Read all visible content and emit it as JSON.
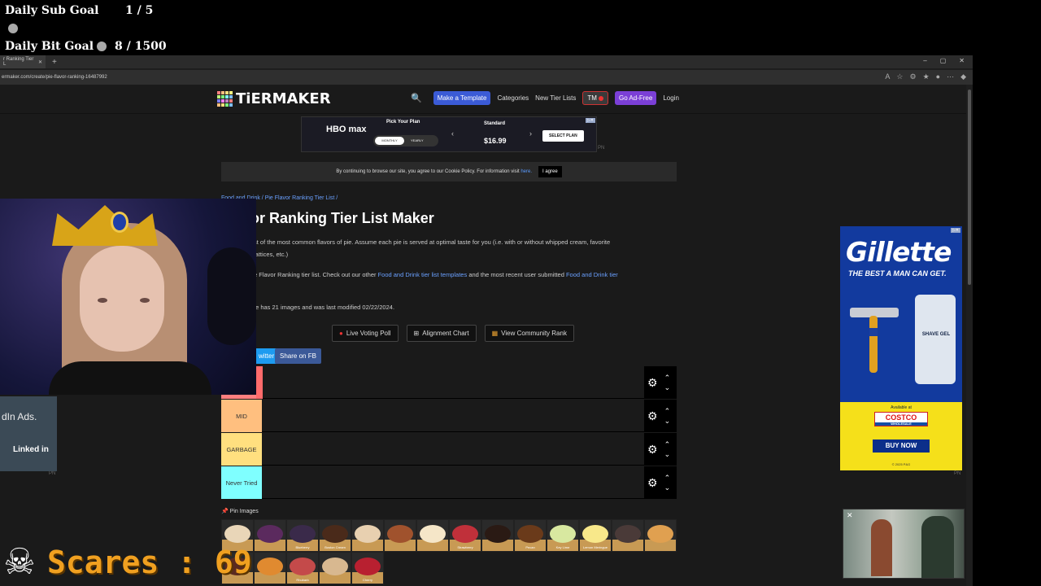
{
  "stream_overlay": {
    "sub_goal_label": "Daily Sub Goal",
    "sub_goal_value": "1 / 5",
    "bit_goal_label": "Daily Bit Goal",
    "bit_goal_value": "8 / 1500",
    "scares_label": "Scares : 69"
  },
  "browser": {
    "tab_title": "r Ranking Tier L",
    "url": "ermaker.com/create/pie-flavor-ranking-16487992"
  },
  "site": {
    "logo_text": "TiERMAKER",
    "nav": {
      "make_template": "Make a Template",
      "categories": "Categories",
      "new_tier_lists": "New Tier Lists",
      "tm": "TM",
      "ad_free": "Go Ad-Free",
      "login": "Login"
    },
    "cookie": {
      "text": "By continuing to browse our site, you agree to our Cookie Policy. For information visit",
      "link": "here.",
      "agree": "I agree"
    },
    "breadcrumb": "Food and Drink / Pie Flavor Ranking Tier List /",
    "title": "Flavor Ranking Tier List Maker",
    "desc1": "st of the most common flavors of pie. Assume each pie is served at optimal taste for you (i.e. with or without whipped cream, favorite",
    "desc2": "lattices, etc.)",
    "desc3_a": "e Flavor Ranking tier list. Check out our other",
    "desc3_link": "Food and Drink tier list templates",
    "desc3_b": "and the most recent user submitted",
    "desc3_link2": "Food and Drink tier",
    "desc4": "te has 21 images and was last modified 02/22/2024.",
    "actions": {
      "live_voting": "Live Voting Poll",
      "alignment": "Alignment Chart",
      "community": "View Community Rank"
    },
    "share_twitter": "witter",
    "share_fb": "Share on FB",
    "tiers": [
      {
        "label": "",
        "color": "#ff7f7f"
      },
      {
        "label": "MID",
        "color": "#ffbf7f"
      },
      {
        "label": "GARBAGE",
        "color": "#ffdf7f"
      },
      {
        "label": "Never Tried",
        "color": "#7fffff"
      }
    ],
    "pin_images": "Pin Images",
    "pie_images": [
      {
        "name": "",
        "color": "#e9d6b8"
      },
      {
        "name": "",
        "color": "#5b2a5e"
      },
      {
        "name": "Blueberry",
        "color": "#3a2a4a"
      },
      {
        "name": "Boston Cream",
        "color": "#4a2a1a"
      },
      {
        "name": "",
        "color": "#e8d0b0"
      },
      {
        "name": "",
        "color": "#a0522d"
      },
      {
        "name": "",
        "color": "#f5e6c8"
      },
      {
        "name": "Strawberry",
        "color": "#c0303a"
      },
      {
        "name": "",
        "color": "#2a1a14"
      },
      {
        "name": "Pecan",
        "color": "#6a3a1a"
      },
      {
        "name": "Key Lime",
        "color": "#d8e8a0"
      },
      {
        "name": "Lemon Meringue",
        "color": "#f8e88a"
      },
      {
        "name": "",
        "color": "#4a3a38"
      },
      {
        "name": "",
        "color": "#e0a050"
      },
      {
        "name": "",
        "color": "#5a2a20"
      },
      {
        "name": "",
        "color": "#e08a30"
      },
      {
        "name": "Rhubarb",
        "color": "#c44a4a"
      },
      {
        "name": "",
        "color": "#d8b890"
      },
      {
        "name": "Cherry",
        "color": "#b82030"
      }
    ]
  },
  "ads": {
    "hbo": {
      "brand": "HBO max",
      "pick": "Pick Your Plan",
      "monthly": "MONTHLY",
      "yearly": "YEARLY",
      "standard": "Standard",
      "price": "$16.99",
      "select": "SELECT PLAN"
    },
    "gillette": {
      "brand": "Gillette",
      "tagline": "THE BEST A MAN CAN GET.",
      "shave": "SHAVE GEL",
      "available": "Available at",
      "costco": "COSTCO",
      "wholesale": "WHOLESALE",
      "buy": "BUY NOW",
      "copyright": "© 2025 P&G"
    },
    "linkedin": {
      "text": "dIn Ads.",
      "logo": "Linked in"
    },
    "pn": "PN"
  }
}
